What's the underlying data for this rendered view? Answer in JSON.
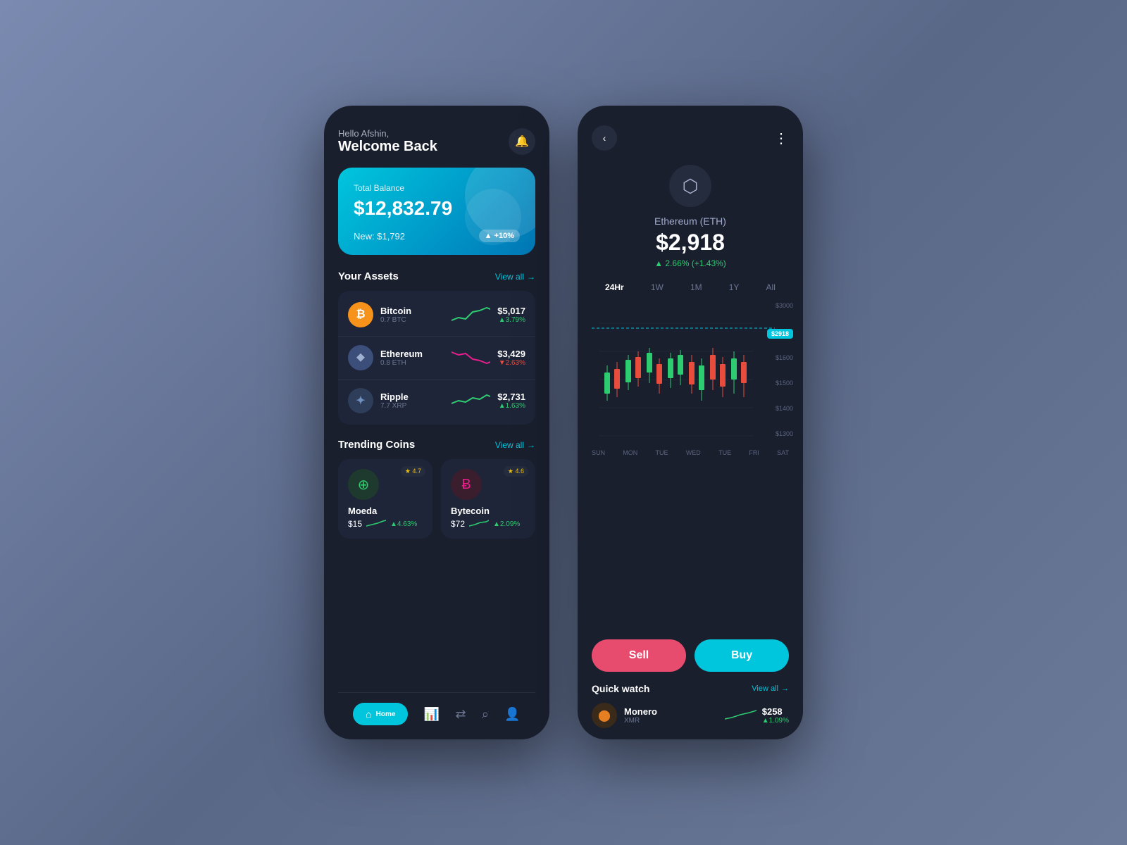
{
  "background": "#6b7a99",
  "left_phone": {
    "greeting": "Hello Afshin,",
    "welcome": "Welcome Back",
    "balance_card": {
      "label": "Total Balance",
      "amount": "$12,832.79",
      "new_label": "New: $1,792",
      "change": "▲ +10%"
    },
    "assets": {
      "title": "Your Assets",
      "view_all": "View all",
      "items": [
        {
          "name": "Bitcoin",
          "sub": "0.7 BTC",
          "price": "$5,017",
          "change": "▲3.79%",
          "direction": "up",
          "color": "#f7931a",
          "symbol": "₿"
        },
        {
          "name": "Ethereum",
          "sub": "0.8 ETH",
          "price": "$3,429",
          "change": "▼2.63%",
          "direction": "down",
          "color": "#3c4e7a",
          "symbol": "⬥"
        },
        {
          "name": "Ripple",
          "sub": "7.7 XRP",
          "price": "$2,731",
          "change": "▲1.63%",
          "direction": "up",
          "color": "#2d3d5a",
          "symbol": "✦"
        }
      ]
    },
    "trending": {
      "title": "Trending Coins",
      "view_all": "View all",
      "items": [
        {
          "name": "Moeda",
          "price": "$15",
          "change": "▲4.63%",
          "rating": "★4.7",
          "symbol": "⊕",
          "bg": "#1e3a2e",
          "color": "#2ecc71"
        },
        {
          "name": "Bytecoin",
          "price": "$72",
          "change": "▲2.09%",
          "rating": "★4.6",
          "symbol": "Ƀ",
          "bg": "#3a1e2e",
          "color": "#e91e8c"
        }
      ]
    },
    "bottom_nav": [
      {
        "label": "Home",
        "icon": "⌂",
        "active": true
      },
      {
        "label": "Chart",
        "icon": "📈",
        "active": false
      },
      {
        "label": "Swap",
        "icon": "⇄",
        "active": false
      },
      {
        "label": "Search",
        "icon": "⌕",
        "active": false
      },
      {
        "label": "Profile",
        "icon": "👤",
        "active": false
      }
    ]
  },
  "right_phone": {
    "coin_name": "Ethereum (ETH)",
    "coin_price": "$2,918",
    "coin_change": "▲ 2.66% (+1.43%)",
    "time_tabs": [
      "24Hr",
      "1W",
      "1M",
      "1Y",
      "All"
    ],
    "active_tab": "24Hr",
    "current_price_badge": "$2918",
    "price_levels": [
      "$3000",
      "$1600",
      "$1500",
      "$1400",
      "$1300"
    ],
    "x_labels": [
      "SUN",
      "MON",
      "TUE",
      "WED",
      "TUE",
      "FRI",
      "SAT"
    ],
    "sell_label": "Sell",
    "buy_label": "Buy",
    "quick_watch": {
      "title": "Quick watch",
      "view_all": "View all",
      "item": {
        "name": "Monero",
        "sub": "XMR",
        "price": "$258",
        "change": "▲1.09%"
      }
    }
  }
}
